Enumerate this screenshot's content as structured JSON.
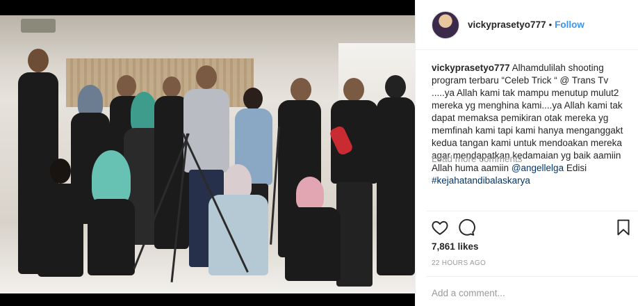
{
  "post": {
    "username": "vickyprasetyo777",
    "follow_separator": "•",
    "follow_label": "Follow",
    "caption": {
      "username": "vickyprasetyo777",
      "text_1": "Alhamdulilah shooting program terbaru “Celeb Trick “ @ Trans Tv .....ya Allah kami tak mampu menutup mulut2 mereka yg menghina kami....ya Allah kami tak dapat memaksa pemikiran otak mereka yg memfinah kami tapi kami hanya menganggakt kedua tangan kami untuk mendoakan mereka agar mendapatkan kedamaian yg baik aamiin Allah huma aamiin ",
      "mention": "@angellelga",
      "text_2": " Edisi ",
      "hashtag": "#kejahatandibalaskarya"
    },
    "load_more": "Load more comments",
    "likes": "7,861 likes",
    "timestamp": "22 HOURS AGO",
    "comment_placeholder": "Add a comment..."
  },
  "icons": {
    "like": "heart-icon",
    "comment": "comment-bubble-icon",
    "save": "bookmark-icon"
  },
  "colors": {
    "link": "#003569",
    "follow": "#3897f0",
    "muted": "#999999",
    "border": "#efefef"
  }
}
